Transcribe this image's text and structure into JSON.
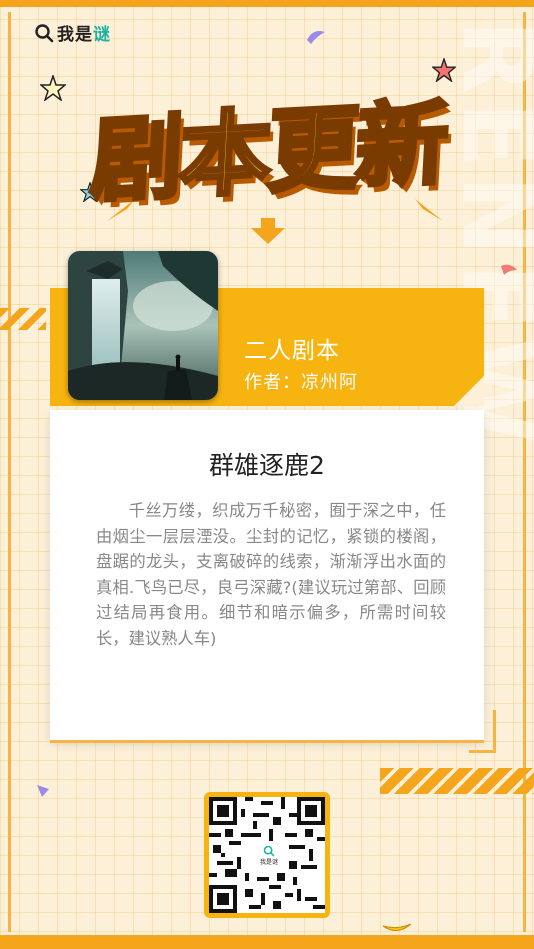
{
  "logo": {
    "text_main": "我是",
    "text_accent": "谜",
    "icon": "search-icon"
  },
  "header": {
    "title": "剧本更新",
    "watermark": "RENEW"
  },
  "script": {
    "type": "二人剧本",
    "author_line": "作者：凉州阿",
    "title": "群雄逐鹿2",
    "description": "千丝万缕，织成万千秘密，囿于深之中，任由烟尘一层层湮没。尘封的记忆，紧锁的楼阁，盘踞的龙头，支离破碎的线索，渐渐浮出水面的真相.飞鸟已尽，良弓深藏?(建议玩过第部、回顾过结局再食用。细节和暗示偏多，所需时间较长，建议熟人车)"
  },
  "qr": {
    "center_text": "我是谜"
  },
  "colors": {
    "accent": "#f7b30f",
    "background": "#fdf0d8",
    "title_fill": "#fcc21a",
    "title_stroke": "#7a3b00"
  }
}
